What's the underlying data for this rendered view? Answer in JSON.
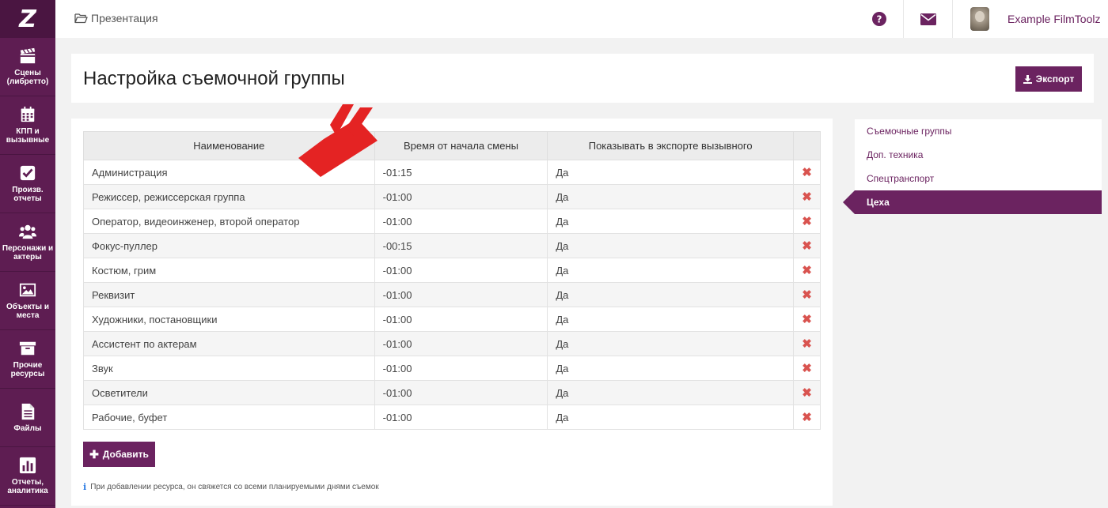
{
  "app": {
    "logo": "Z",
    "brand_color": "#6b2360",
    "sidebar_color": "#5e1d52"
  },
  "sidebar": {
    "items": [
      {
        "label": "Сцены\n(либретто)",
        "icon": "clapperboard-icon"
      },
      {
        "label": "КПП и\nвызывные",
        "icon": "calendar-icon"
      },
      {
        "label": "Произв.\nотчеты",
        "icon": "checkbox-icon"
      },
      {
        "label": "Персонажи и\nактеры",
        "icon": "users-icon"
      },
      {
        "label": "Объекты и\nместа",
        "icon": "image-icon"
      },
      {
        "label": "Прочие\nресурсы",
        "icon": "archive-icon"
      },
      {
        "label": "Файлы",
        "icon": "file-icon"
      },
      {
        "label": "Отчеты,\nаналитика",
        "icon": "bar-chart-icon"
      }
    ]
  },
  "topbar": {
    "breadcrumb": "Презентация",
    "help_icon": "question-circle-icon",
    "mail_icon": "envelope-icon",
    "user_name": "Example FilmToolz"
  },
  "header": {
    "title": "Настройка съемочной группы",
    "export_label": "Экспорт"
  },
  "table": {
    "columns": [
      "Наименование",
      "Время от начала смены",
      "Показывать в экспорте вызывного"
    ],
    "rows": [
      {
        "name": "Администрация",
        "time": "-01:15",
        "show": "Да"
      },
      {
        "name": "Режиссер, режиссерская группа",
        "time": "-01:00",
        "show": "Да"
      },
      {
        "name": "Оператор, видеоинженер, второй оператор",
        "time": "-01:00",
        "show": "Да"
      },
      {
        "name": "Фокус-пуллер",
        "time": "-00:15",
        "show": "Да"
      },
      {
        "name": "Костюм, грим",
        "time": "-01:00",
        "show": "Да"
      },
      {
        "name": "Реквизит",
        "time": "-01:00",
        "show": "Да"
      },
      {
        "name": "Художники, постановщики",
        "time": "-01:00",
        "show": "Да"
      },
      {
        "name": "Ассистент по актерам",
        "time": "-01:00",
        "show": "Да"
      },
      {
        "name": "Звук",
        "time": "-01:00",
        "show": "Да"
      },
      {
        "name": "Осветители",
        "time": "-01:00",
        "show": "Да"
      },
      {
        "name": "Рабочие, буфет",
        "time": "-01:00",
        "show": "Да"
      }
    ],
    "delete_symbol": "✖"
  },
  "actions": {
    "add_label": "Добавить"
  },
  "hint": "При добавлении ресурса, он свяжется со всеми планируемыми днями съемок",
  "side_menu": {
    "items": [
      "Съемочные группы",
      "Доп. техника",
      "Спецтранспорт",
      "Цеха"
    ],
    "active_index": 3
  }
}
